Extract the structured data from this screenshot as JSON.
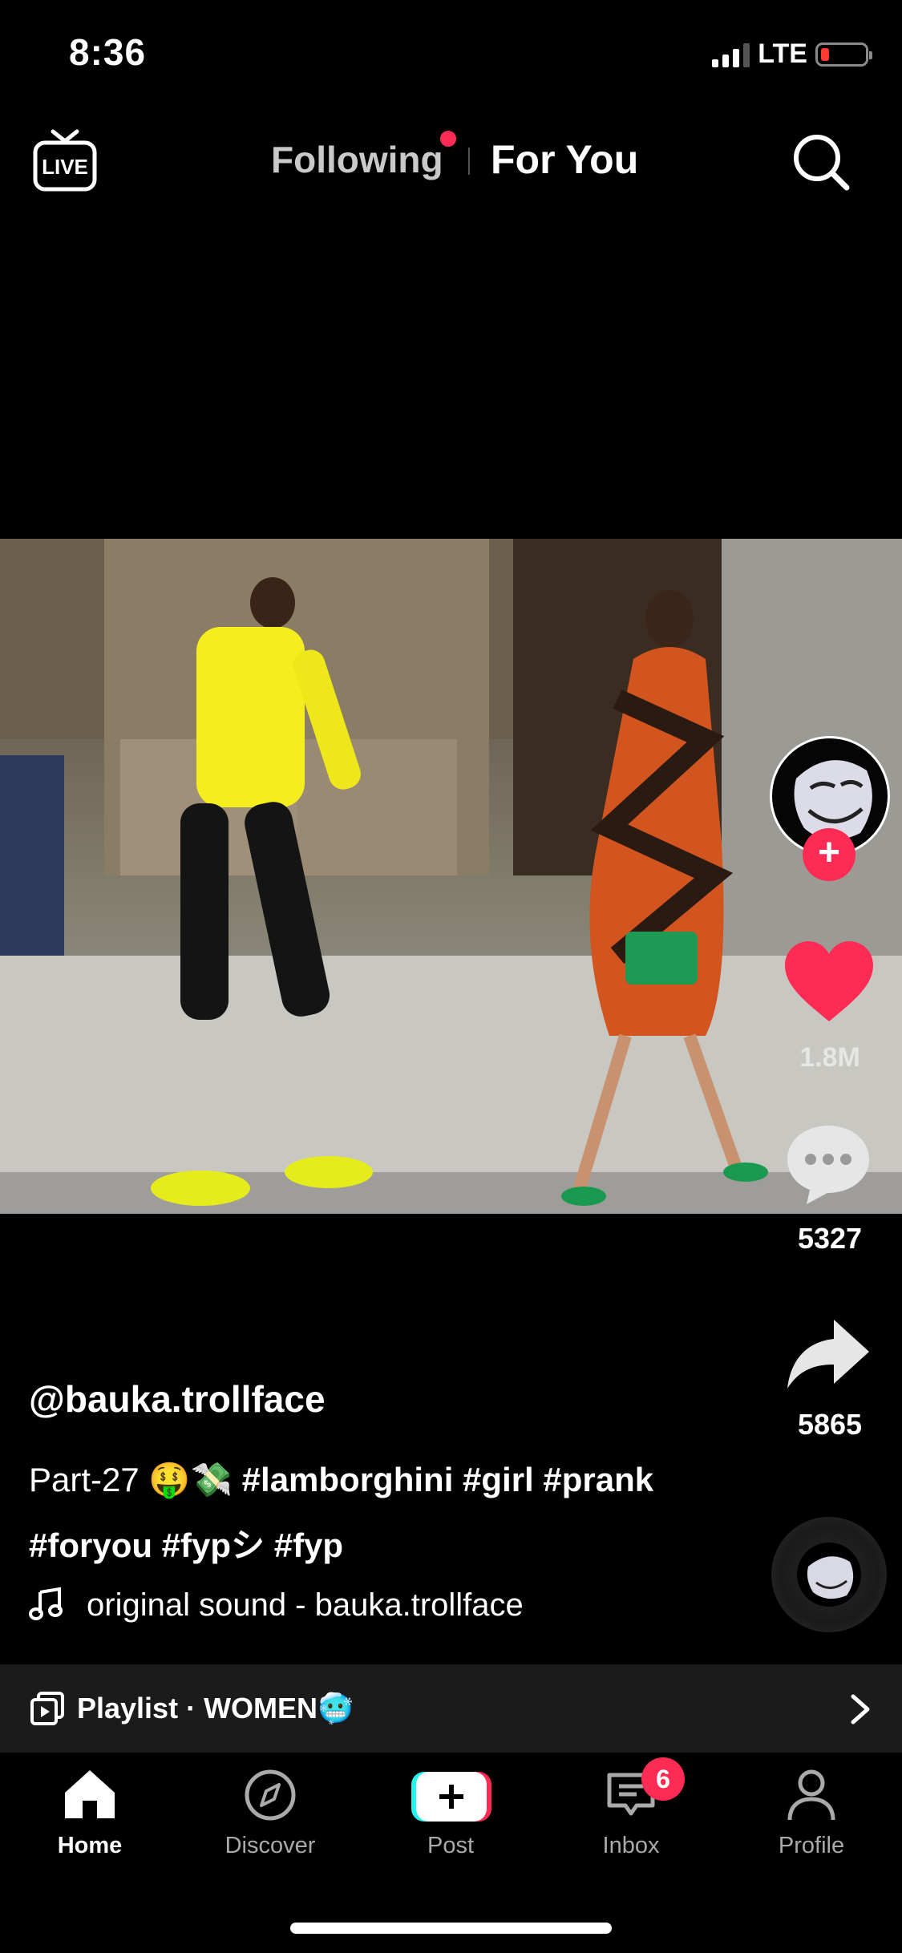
{
  "status_bar": {
    "time": "8:36",
    "network": "LTE"
  },
  "top_nav": {
    "tabs": [
      "Following",
      "For You"
    ],
    "active_tab": "For You",
    "live_label": "LIVE"
  },
  "video": {
    "creator_handle": "@bauka.trollface"
  },
  "actions": {
    "likes": "1.8M",
    "comments": "5327",
    "shares": "5865"
  },
  "caption": {
    "username": "@bauka.trollface",
    "line1_prefix": "Part-27 🤑💸",
    "line1_tags": "#lamborghini #girl #prank",
    "line2_tags": "#foryou #fypシ #fyp",
    "sound": "original sound - bauka.trollface"
  },
  "playlist": {
    "label": "Playlist · WOMEN🥶"
  },
  "bottom_nav": {
    "items": [
      "Home",
      "Discover",
      "Post",
      "Inbox",
      "Profile"
    ],
    "active": "Home",
    "inbox_badge": "6"
  },
  "colors": {
    "accent": "#fe2c55",
    "background": "#000000",
    "inactive_text": "#aaaaaa"
  },
  "icons": [
    "live-icon",
    "search-icon",
    "heart-icon",
    "comment-icon",
    "share-icon",
    "music-note-icon",
    "playlist-icon",
    "chevron-right-icon",
    "home-icon",
    "compass-icon",
    "plus-icon",
    "inbox-icon",
    "profile-icon"
  ]
}
